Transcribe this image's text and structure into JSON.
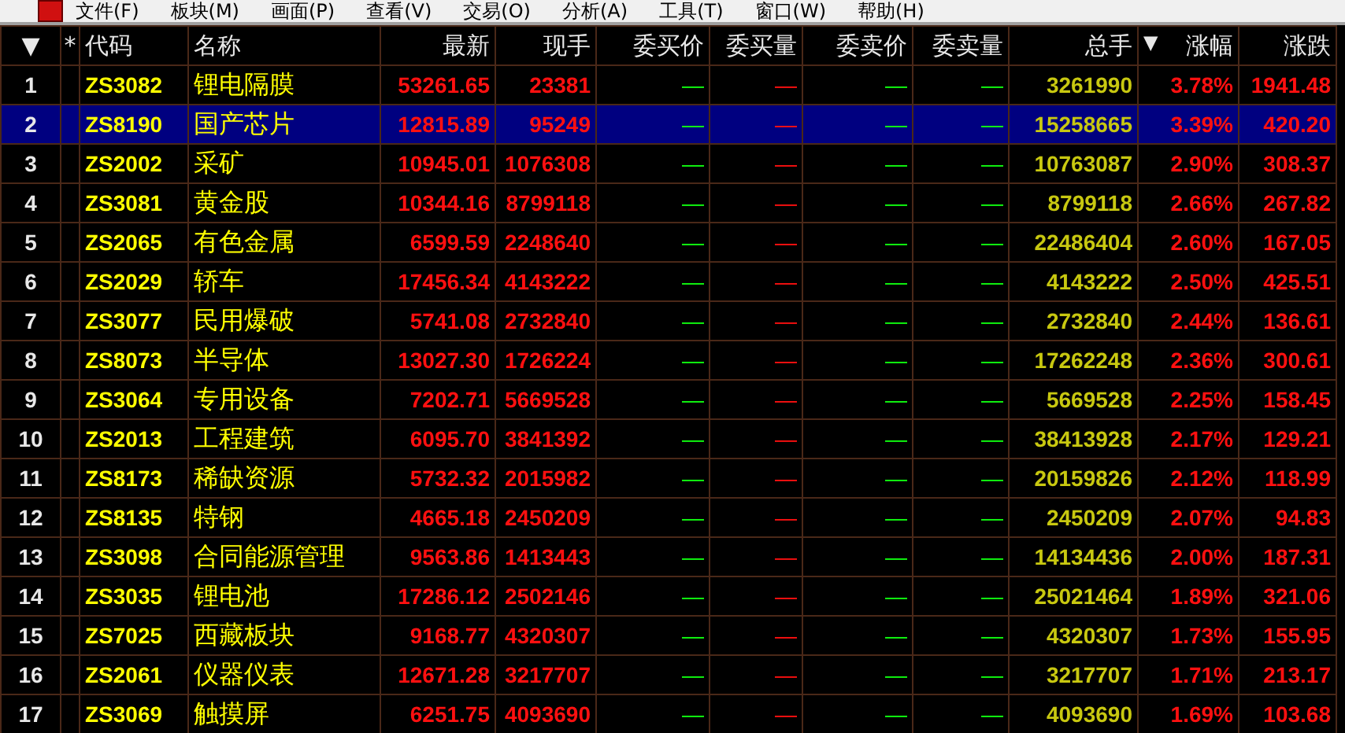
{
  "menu": [
    "文件(F)",
    "板块(M)",
    "画面(P)",
    "查看(V)",
    "交易(O)",
    "分析(A)",
    "工具(T)",
    "窗口(W)",
    "帮助(H)"
  ],
  "table": {
    "columns": [
      {
        "label": "▼"
      },
      {
        "label": "*"
      },
      {
        "label": "代码"
      },
      {
        "label": "名称"
      },
      {
        "label": "最新"
      },
      {
        "label": "现手"
      },
      {
        "label": "委买价"
      },
      {
        "label": "委买量"
      },
      {
        "label": "委卖价"
      },
      {
        "label": "委卖量"
      },
      {
        "label": "总手"
      },
      {
        "label": "涨幅",
        "sort_mark": "▼"
      },
      {
        "label": "涨跌"
      }
    ],
    "rows": [
      {
        "index": "1",
        "code": "ZS3082",
        "name": "锂电隔膜",
        "latest": "53261.65",
        "volume_now": "23381",
        "bid_price": "—",
        "bid_volume": "—",
        "ask_price": "—",
        "ask_volume": "—",
        "total_volume": "3261990",
        "change_pct": "3.78%",
        "change": "1941.48",
        "selected": false
      },
      {
        "index": "2",
        "code": "ZS8190",
        "name": "国产芯片",
        "latest": "12815.89",
        "volume_now": "95249",
        "bid_price": "—",
        "bid_volume": "—",
        "ask_price": "—",
        "ask_volume": "—",
        "total_volume": "15258665",
        "change_pct": "3.39%",
        "change": "420.20",
        "selected": true
      },
      {
        "index": "3",
        "code": "ZS2002",
        "name": "采矿",
        "latest": "10945.01",
        "volume_now": "1076308",
        "bid_price": "—",
        "bid_volume": "—",
        "ask_price": "—",
        "ask_volume": "—",
        "total_volume": "10763087",
        "change_pct": "2.90%",
        "change": "308.37",
        "selected": false
      },
      {
        "index": "4",
        "code": "ZS3081",
        "name": "黄金股",
        "latest": "10344.16",
        "volume_now": "8799118",
        "bid_price": "—",
        "bid_volume": "—",
        "ask_price": "—",
        "ask_volume": "—",
        "total_volume": "8799118",
        "change_pct": "2.66%",
        "change": "267.82",
        "selected": false
      },
      {
        "index": "5",
        "code": "ZS2065",
        "name": "有色金属",
        "latest": "6599.59",
        "volume_now": "2248640",
        "bid_price": "—",
        "bid_volume": "—",
        "ask_price": "—",
        "ask_volume": "—",
        "total_volume": "22486404",
        "change_pct": "2.60%",
        "change": "167.05",
        "selected": false
      },
      {
        "index": "6",
        "code": "ZS2029",
        "name": "轿车",
        "latest": "17456.34",
        "volume_now": "4143222",
        "bid_price": "—",
        "bid_volume": "—",
        "ask_price": "—",
        "ask_volume": "—",
        "total_volume": "4143222",
        "change_pct": "2.50%",
        "change": "425.51",
        "selected": false
      },
      {
        "index": "7",
        "code": "ZS3077",
        "name": "民用爆破",
        "latest": "5741.08",
        "volume_now": "2732840",
        "bid_price": "—",
        "bid_volume": "—",
        "ask_price": "—",
        "ask_volume": "—",
        "total_volume": "2732840",
        "change_pct": "2.44%",
        "change": "136.61",
        "selected": false
      },
      {
        "index": "8",
        "code": "ZS8073",
        "name": "半导体",
        "latest": "13027.30",
        "volume_now": "1726224",
        "bid_price": "—",
        "bid_volume": "—",
        "ask_price": "—",
        "ask_volume": "—",
        "total_volume": "17262248",
        "change_pct": "2.36%",
        "change": "300.61",
        "selected": false
      },
      {
        "index": "9",
        "code": "ZS3064",
        "name": "专用设备",
        "latest": "7202.71",
        "volume_now": "5669528",
        "bid_price": "—",
        "bid_volume": "—",
        "ask_price": "—",
        "ask_volume": "—",
        "total_volume": "5669528",
        "change_pct": "2.25%",
        "change": "158.45",
        "selected": false
      },
      {
        "index": "10",
        "code": "ZS2013",
        "name": "工程建筑",
        "latest": "6095.70",
        "volume_now": "3841392",
        "bid_price": "—",
        "bid_volume": "—",
        "ask_price": "—",
        "ask_volume": "—",
        "total_volume": "38413928",
        "change_pct": "2.17%",
        "change": "129.21",
        "selected": false
      },
      {
        "index": "11",
        "code": "ZS8173",
        "name": "稀缺资源",
        "latest": "5732.32",
        "volume_now": "2015982",
        "bid_price": "—",
        "bid_volume": "—",
        "ask_price": "—",
        "ask_volume": "—",
        "total_volume": "20159826",
        "change_pct": "2.12%",
        "change": "118.99",
        "selected": false
      },
      {
        "index": "12",
        "code": "ZS8135",
        "name": "特钢",
        "latest": "4665.18",
        "volume_now": "2450209",
        "bid_price": "—",
        "bid_volume": "—",
        "ask_price": "—",
        "ask_volume": "—",
        "total_volume": "2450209",
        "change_pct": "2.07%",
        "change": "94.83",
        "selected": false
      },
      {
        "index": "13",
        "code": "ZS3098",
        "name": "合同能源管理",
        "latest": "9563.86",
        "volume_now": "1413443",
        "bid_price": "—",
        "bid_volume": "—",
        "ask_price": "—",
        "ask_volume": "—",
        "total_volume": "14134436",
        "change_pct": "2.00%",
        "change": "187.31",
        "selected": false
      },
      {
        "index": "14",
        "code": "ZS3035",
        "name": "锂电池",
        "latest": "17286.12",
        "volume_now": "2502146",
        "bid_price": "—",
        "bid_volume": "—",
        "ask_price": "—",
        "ask_volume": "—",
        "total_volume": "25021464",
        "change_pct": "1.89%",
        "change": "321.06",
        "selected": false
      },
      {
        "index": "15",
        "code": "ZS7025",
        "name": "西藏板块",
        "latest": "9168.77",
        "volume_now": "4320307",
        "bid_price": "—",
        "bid_volume": "—",
        "ask_price": "—",
        "ask_volume": "—",
        "total_volume": "4320307",
        "change_pct": "1.73%",
        "change": "155.95",
        "selected": false
      },
      {
        "index": "16",
        "code": "ZS2061",
        "name": "仪器仪表",
        "latest": "12671.28",
        "volume_now": "3217707",
        "bid_price": "—",
        "bid_volume": "—",
        "ask_price": "—",
        "ask_volume": "—",
        "total_volume": "3217707",
        "change_pct": "1.71%",
        "change": "213.17",
        "selected": false
      },
      {
        "index": "17",
        "code": "ZS3069",
        "name": "触摸屏",
        "latest": "6251.75",
        "volume_now": "4093690",
        "bid_price": "—",
        "bid_volume": "—",
        "ask_price": "—",
        "ask_volume": "—",
        "total_volume": "4093690",
        "change_pct": "1.69%",
        "change": "103.68",
        "selected": false
      }
    ]
  }
}
